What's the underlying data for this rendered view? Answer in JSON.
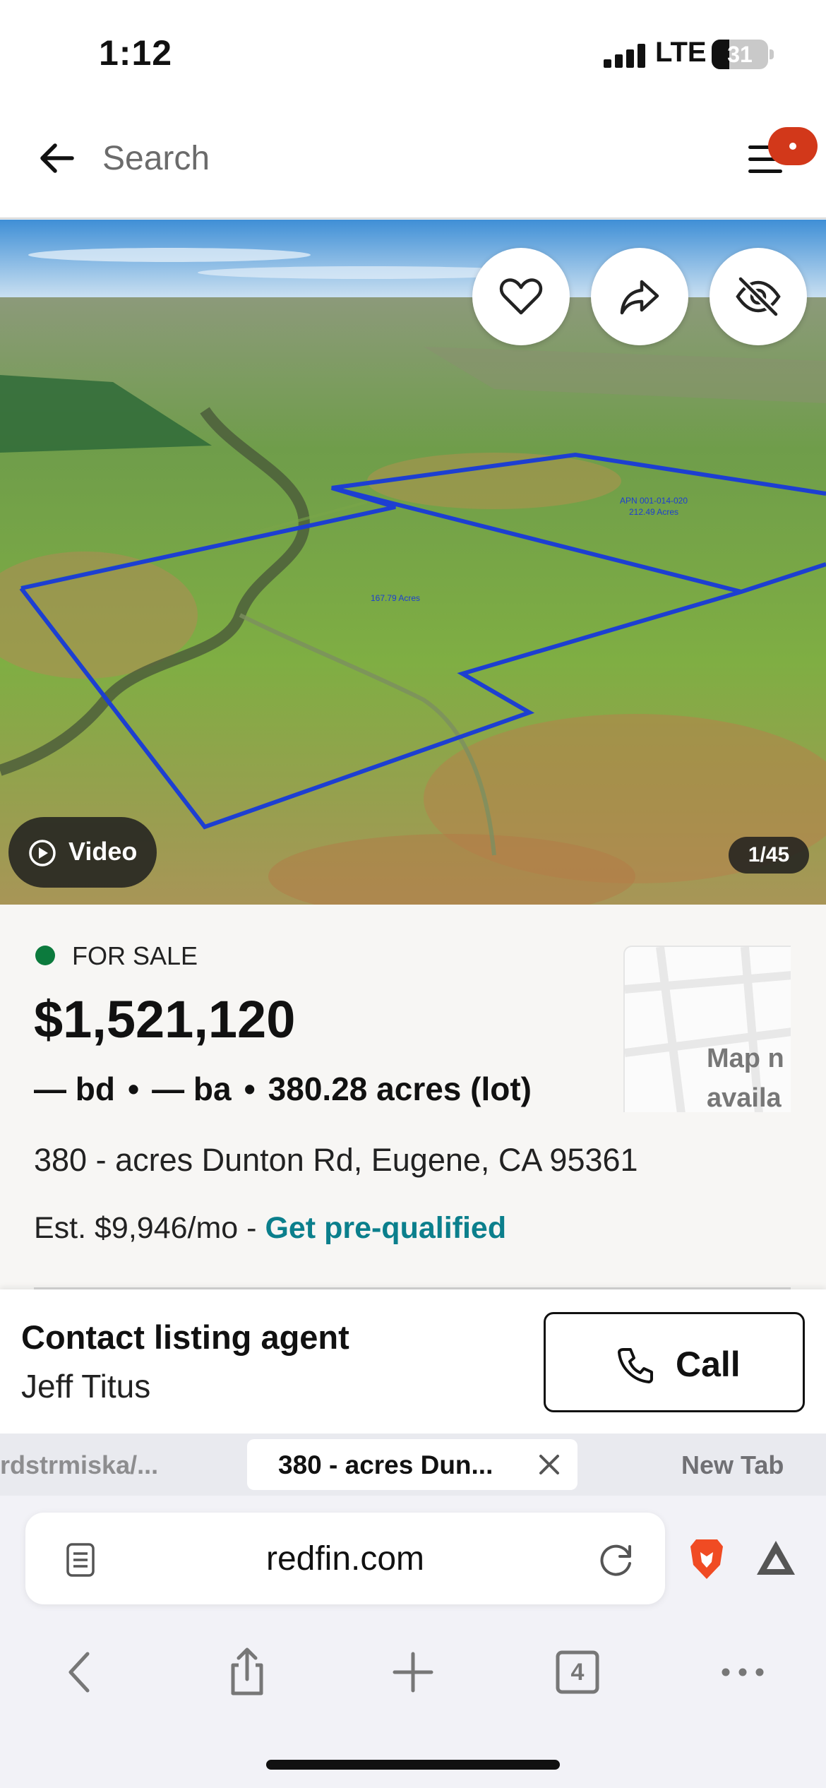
{
  "status_bar": {
    "time": "1:12",
    "network": "LTE",
    "battery": "31",
    "battery_level": 0.31
  },
  "search": {
    "placeholder": "Search"
  },
  "hero": {
    "video_label": "Video",
    "photo_counter": "1/45"
  },
  "listing": {
    "status": "FOR SALE",
    "price": "$1,521,120",
    "beds": "— bd",
    "baths": "— ba",
    "lot": "380.28 acres (lot)",
    "separator": "•",
    "address": "380 - acres Dunton Rd, Eugene, CA 95361",
    "estimate_prefix": "Est. $9,946/mo - ",
    "prequal_link": "Get pre-qualified",
    "map_placeholder": "Map n availa"
  },
  "contact": {
    "title": "Contact listing agent",
    "agent_name": "Jeff Titus",
    "call_label": "Call"
  },
  "browser": {
    "tabs": {
      "left": "rdstrmiska/...",
      "active": "380 - acres Dun...",
      "right": "New Tab"
    },
    "url": "redfin.com",
    "tab_count": "4"
  },
  "icons": {
    "back": "back-arrow-icon",
    "menu": "hamburger-menu-icon",
    "favorite": "heart-icon",
    "share": "share-arrow-icon",
    "hide": "eye-off-icon",
    "video": "play-icon",
    "call": "phone-icon",
    "reader": "page-icon",
    "reload": "reload-icon",
    "brave": "brave-lion-icon",
    "rewards": "triangle-rewards-icon"
  },
  "colors": {
    "status_dot": "#0c7a3d",
    "link": "#0b7f8c",
    "badge": "#d2381a",
    "parcel_outline": "#1d3fd1"
  }
}
